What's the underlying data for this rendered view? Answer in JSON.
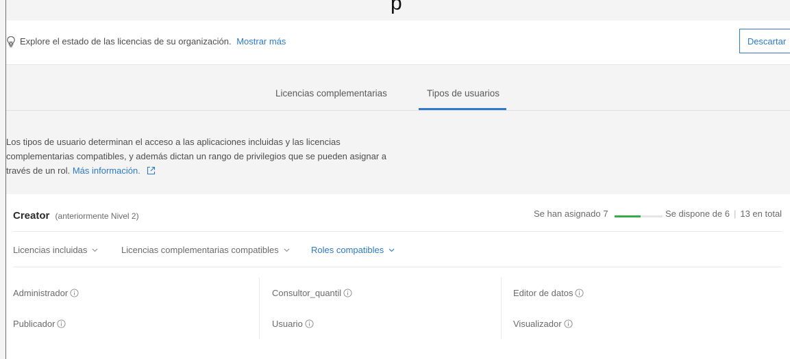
{
  "top": {
    "cut_label": "p"
  },
  "banner": {
    "message": "Explore el estado de las licencias de su organización.",
    "link_label": "Mostrar más",
    "dismiss_label": "Descartar"
  },
  "tabs": [
    {
      "label": "Licencias complementarias",
      "active": false
    },
    {
      "label": "Tipos de usuarios",
      "active": true
    }
  ],
  "description": {
    "text": "Los tipos de usuario determinan el acceso a las aplicaciones incluidas y las licencias complementarias compatibles, y además dictan un rango de privilegios que se pueden asignar a través de un rol.",
    "more_label": "Más información."
  },
  "user_type": {
    "name": "Creator",
    "subtitle": "(anteriormente Nivel 2)",
    "assigned_text": "Se han asignado 7",
    "available_text": "Se dispone de 6",
    "total_text": "13 en total",
    "assigned_fraction": 0.54
  },
  "dropdowns": [
    {
      "label": "Licencias incluidas"
    },
    {
      "label": "Licencias complementarias compatibles"
    },
    {
      "label": "Roles compatibles"
    }
  ],
  "roles": [
    {
      "label": "Administrador"
    },
    {
      "label": "Consultor_quantil"
    },
    {
      "label": "Editor de datos"
    },
    {
      "label": "Publicador"
    },
    {
      "label": "Usuario"
    },
    {
      "label": "Visualizador"
    }
  ],
  "colors": {
    "accent": "#2c7ac9",
    "progress": "#35ac46"
  },
  "icons": [
    "lightbulb-icon",
    "external-link-icon",
    "chevron-down-icon",
    "info-icon"
  ]
}
